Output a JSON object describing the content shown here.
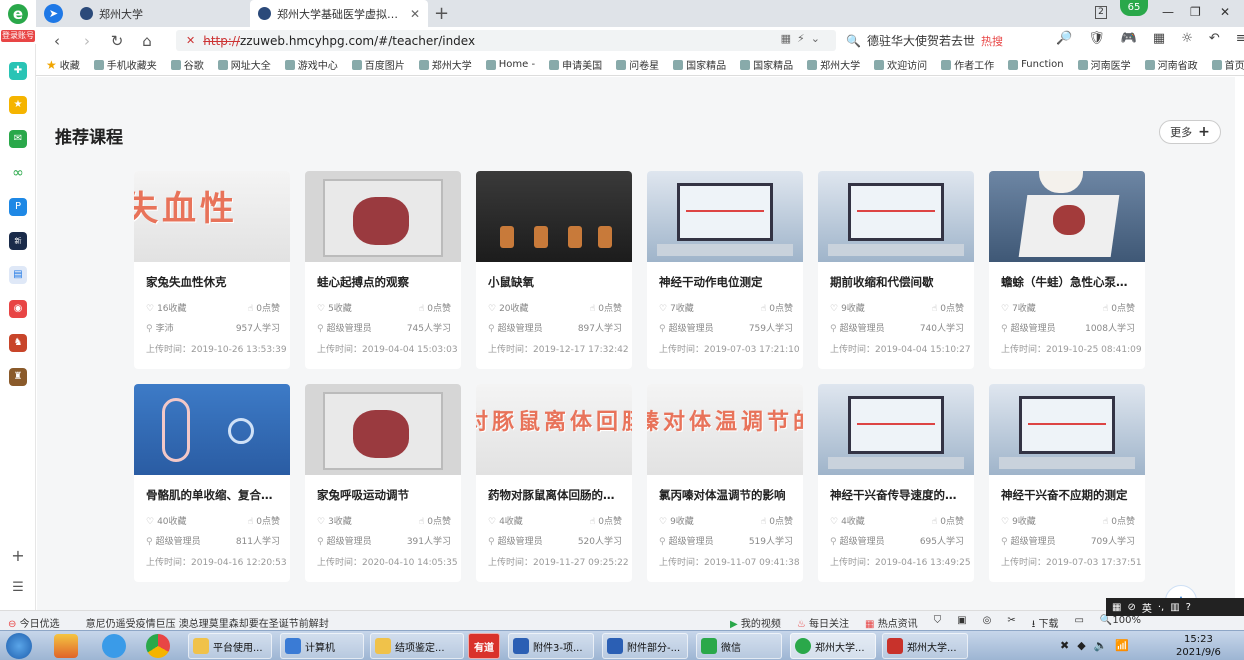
{
  "browser": {
    "logo_badge": "登录账号",
    "tabs": [
      {
        "label": "郑州大学"
      },
      {
        "label": "郑州大学基础医学虚拟仿真实验"
      }
    ],
    "notification_count": "65",
    "window_count": "2",
    "url_protocol": "http://",
    "url_rest": "zzuweb.hmcyhpg.com/#/teacher/index",
    "search_text": "德驻华大使贺若去世",
    "search_hot": "热搜",
    "bookmarks": [
      "收藏",
      "手机收藏夹",
      "谷歌",
      "网址大全",
      "游戏中心",
      "百度图片",
      "郑州大学",
      "Home -",
      "申请美国",
      "问卷星",
      "国家精品",
      "国家精品",
      "郑州大学",
      "欢迎访问",
      "作者工作",
      "Function",
      "河南医学",
      "河南省政",
      "首页 -"
    ]
  },
  "section": {
    "title": "推荐课程",
    "more_label": "更多"
  },
  "courses": [
    {
      "title": "家兔失血性休克",
      "favorites": "16收藏",
      "likes": "0点赞",
      "author": "李沛",
      "learners": "957人学习",
      "upload": "上传时间：2019-10-26 13:53:39",
      "banner": "失血性"
    },
    {
      "title": "蛙心起搏点的观察",
      "favorites": "5收藏",
      "likes": "0点赞",
      "author": "超级管理员",
      "learners": "745人学习",
      "upload": "上传时间：2019-04-04 15:03:03"
    },
    {
      "title": "小鼠缺氧",
      "favorites": "20收藏",
      "likes": "0点赞",
      "author": "超级管理员",
      "learners": "897人学习",
      "upload": "上传时间：2019-12-17 17:32:42"
    },
    {
      "title": "神经干动作电位测定",
      "favorites": "7收藏",
      "likes": "0点赞",
      "author": "超级管理员",
      "learners": "759人学习",
      "upload": "上传时间：2019-07-03 17:21:10"
    },
    {
      "title": "期前收缩和代偿间歇",
      "favorites": "9收藏",
      "likes": "0点赞",
      "author": "超级管理员",
      "learners": "740人学习",
      "upload": "上传时间：2019-04-04 15:10:27"
    },
    {
      "title": "蟾蜍（牛蛙）急性心泵功能",
      "favorites": "7收藏",
      "likes": "0点赞",
      "author": "超级管理员",
      "learners": "1008人学习",
      "upload": "上传时间：2019-10-25 08:41:09"
    },
    {
      "title": "骨骼肌的单收缩、复合收缩",
      "favorites": "40收藏",
      "likes": "0点赞",
      "author": "超级管理员",
      "learners": "811人学习",
      "upload": "上传时间：2019-04-16 12:20:53"
    },
    {
      "title": "家兔呼吸运动调节",
      "favorites": "3收藏",
      "likes": "0点赞",
      "author": "超级管理员",
      "learners": "391人学习",
      "upload": "上传时间：2020-04-10 14:05:35"
    },
    {
      "title": "药物对豚鼠离体回肠的影响",
      "favorites": "4收藏",
      "likes": "0点赞",
      "author": "超级管理员",
      "learners": "520人学习",
      "upload": "上传时间：2019-11-27 09:25:22",
      "banner": "对豚鼠离体回肠的"
    },
    {
      "title": "氯丙嗪对体温调节的影响",
      "favorites": "9收藏",
      "likes": "0点赞",
      "author": "超级管理员",
      "learners": "519人学习",
      "upload": "上传时间：2019-11-07 09:41:38",
      "banner": "嗪对体温调节的"
    },
    {
      "title": "神经干兴奋传导速度的测定",
      "favorites": "4收藏",
      "likes": "0点赞",
      "author": "超级管理员",
      "learners": "695人学习",
      "upload": "上传时间：2019-04-16 13:49:25"
    },
    {
      "title": "神经干兴奋不应期的测定",
      "favorites": "9收藏",
      "likes": "0点赞",
      "author": "超级管理员",
      "learners": "709人学习",
      "upload": "上传时间：2019-07-03 17:37:51"
    }
  ],
  "statusbar": {
    "today": "今日优选",
    "headline": "意尼仍遥受疫情巨压 澳总理莫里森却要在圣诞节前解封",
    "video": "我的视频",
    "daily": "每日关注",
    "hot": "热点资讯",
    "download": "下载",
    "zoom": "100%"
  },
  "ime": {
    "lang": "英"
  },
  "taskbar": {
    "tasks": [
      "平台使用...",
      "计算机",
      "结项鉴定...",
      "附件3-项...",
      "附件部分-...",
      "微信",
      "郑州大学...",
      "郑州大学..."
    ],
    "youdao": "有道",
    "time": "15:23",
    "date": "2021/9/6"
  }
}
